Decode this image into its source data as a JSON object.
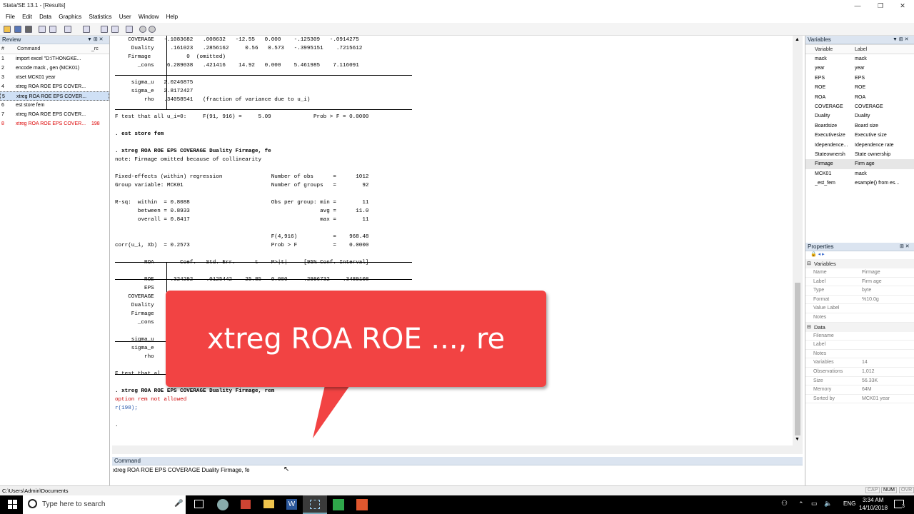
{
  "app_title": "Stata/SE 13.1 - [Results]",
  "window_controls": [
    "—",
    "❐",
    "✕"
  ],
  "menu": [
    "File",
    "Edit",
    "Data",
    "Graphics",
    "Statistics",
    "User",
    "Window",
    "Help"
  ],
  "review": {
    "title": "Review",
    "columns": [
      "#",
      "Command",
      "_rc"
    ],
    "rows": [
      {
        "n": "1",
        "cmd": "import excel \"D:\\THONGKE...",
        "rc": "",
        "state": ""
      },
      {
        "n": "2",
        "cmd": "encode mack , gen (MCK01)",
        "rc": "",
        "state": ""
      },
      {
        "n": "3",
        "cmd": "xtset MCK01 year",
        "rc": "",
        "state": ""
      },
      {
        "n": "4",
        "cmd": "xtreg ROA ROE EPS COVER...",
        "rc": "",
        "state": ""
      },
      {
        "n": "5",
        "cmd": "xtreg ROA ROE EPS COVER...",
        "rc": "",
        "state": "sel"
      },
      {
        "n": "6",
        "cmd": "est store fem",
        "rc": "",
        "state": ""
      },
      {
        "n": "7",
        "cmd": "xtreg ROA ROE EPS COVER...",
        "rc": "",
        "state": ""
      },
      {
        "n": "8",
        "cmd": "xtreg ROA ROE EPS COVER...",
        "rc": "198",
        "state": "err"
      }
    ]
  },
  "results_lines": [
    {
      "t": "    COVERAGE   -.1083682   .008632   -12.55   0.000    -.125309   -.0914275",
      "c": ""
    },
    {
      "t": "     Duality     .161023   .2856162     0.56   0.573   -.3995151    .7215612",
      "c": ""
    },
    {
      "t": "    Firmage           0  (omitted)",
      "c": ""
    },
    {
      "t": "       _cons    6.289038   .421416    14.92   0.000    5.461985    7.116091",
      "c": ""
    },
    {
      "t": "",
      "c": ""
    },
    {
      "t": "     sigma_u   2.0246875",
      "c": ""
    },
    {
      "t": "     sigma_e   2.8172427",
      "c": ""
    },
    {
      "t": "         rho   .34058541   (fraction of variance due to u_i)",
      "c": ""
    },
    {
      "t": "",
      "c": ""
    },
    {
      "t": "F test that all u_i=0:     F(91, 916) =     5.09             Prob > F = 0.0000",
      "c": ""
    },
    {
      "t": "",
      "c": ""
    },
    {
      "t": ". est store fem",
      "c": "bold"
    },
    {
      "t": "",
      "c": ""
    },
    {
      "t": ". xtreg ROA ROE EPS COVERAGE Duality Firmage, fe",
      "c": "bold"
    },
    {
      "t": "note: Firmage omitted because of collinearity",
      "c": ""
    },
    {
      "t": "",
      "c": ""
    },
    {
      "t": "Fixed-effects (within) regression               Number of obs      =      1012",
      "c": ""
    },
    {
      "t": "Group variable: MCK01                           Number of groups   =        92",
      "c": ""
    },
    {
      "t": "",
      "c": ""
    },
    {
      "t": "R-sq:  within  = 0.8088                         Obs per group: min =        11",
      "c": ""
    },
    {
      "t": "       between = 0.8933                                        avg =      11.0",
      "c": ""
    },
    {
      "t": "       overall = 0.8417                                        max =        11",
      "c": ""
    },
    {
      "t": "",
      "c": ""
    },
    {
      "t": "                                                F(4,916)           =    968.48",
      "c": ""
    },
    {
      "t": "corr(u_i, Xb)  = 0.2573                         Prob > F           =    0.0000",
      "c": ""
    },
    {
      "t": "",
      "c": ""
    },
    {
      "t": "         ROA        Coef.   Std. Err.      t    P>|t|     [95% Conf. Interval]",
      "c": ""
    },
    {
      "t": "",
      "c": ""
    },
    {
      "t": "         ROE     .324292    .0125442    25.85   0.000     .2996732    .3489108",
      "c": ""
    },
    {
      "t": "         EPS",
      "c": ""
    },
    {
      "t": "    COVERAGE",
      "c": ""
    },
    {
      "t": "     Duality",
      "c": ""
    },
    {
      "t": "     Firmage",
      "c": ""
    },
    {
      "t": "       _cons",
      "c": ""
    },
    {
      "t": "",
      "c": ""
    },
    {
      "t": "     sigma_u",
      "c": ""
    },
    {
      "t": "     sigma_e",
      "c": ""
    },
    {
      "t": "         rho",
      "c": ""
    },
    {
      "t": "",
      "c": ""
    },
    {
      "t": "F test that al",
      "c": ""
    },
    {
      "t": "",
      "c": ""
    },
    {
      "t": ". xtreg ROA ROE EPS COVERAGE Duality Firmage, rem",
      "c": "bold"
    },
    {
      "t": "option rem not allowed",
      "c": "red"
    },
    {
      "t": "r(198);",
      "c": "blue"
    },
    {
      "t": "",
      "c": ""
    },
    {
      "t": ".",
      "c": ""
    }
  ],
  "command": {
    "title": "Command",
    "value": "xtreg ROA ROE EPS COVERAGE Duality Firmage, fe"
  },
  "variables": {
    "title": "Variables",
    "columns": [
      "Variable",
      "Label"
    ],
    "rows": [
      {
        "name": "mack",
        "label": "mack"
      },
      {
        "name": "year",
        "label": "year"
      },
      {
        "name": "EPS",
        "label": "EPS"
      },
      {
        "name": "ROE",
        "label": "ROE"
      },
      {
        "name": "ROA",
        "label": "ROA"
      },
      {
        "name": "COVERAGE",
        "label": "COVERAGE"
      },
      {
        "name": "Duality",
        "label": "Duality"
      },
      {
        "name": "Boardsize",
        "label": "Board size"
      },
      {
        "name": "Executivesize",
        "label": "Executive size"
      },
      {
        "name": "Idependence...",
        "label": "Idependence rate"
      },
      {
        "name": "Stateownersh",
        "label": "State ownership"
      },
      {
        "name": "Firmage",
        "label": "Firm age"
      },
      {
        "name": "MCK01",
        "label": "mack"
      },
      {
        "name": "_est_fem",
        "label": "esample() from es..."
      }
    ]
  },
  "properties": {
    "title": "Properties",
    "sections": [
      {
        "title": "Variables",
        "rows": [
          {
            "k": "Name",
            "v": "Firmage"
          },
          {
            "k": "Label",
            "v": "Firm age"
          },
          {
            "k": "Type",
            "v": "byte"
          },
          {
            "k": "Format",
            "v": "%10.0g"
          },
          {
            "k": "Value Label",
            "v": ""
          },
          {
            "k": "Notes",
            "v": ""
          }
        ]
      },
      {
        "title": "Data",
        "rows": [
          {
            "k": "Filename",
            "v": ""
          },
          {
            "k": "Label",
            "v": ""
          },
          {
            "k": "Notes",
            "v": ""
          },
          {
            "k": "Variables",
            "v": "14"
          },
          {
            "k": "Observations",
            "v": "1,012"
          },
          {
            "k": "Size",
            "v": "56.33K"
          },
          {
            "k": "Memory",
            "v": "64M"
          },
          {
            "k": "Sorted by",
            "v": "MCK01 year"
          }
        ]
      }
    ]
  },
  "status": {
    "path": "C:\\Users\\Admin\\Documents",
    "indicators": [
      "CAP",
      "NUM",
      "OVR"
    ]
  },
  "taskbar": {
    "search_placeholder": "Type here to search",
    "lang": "ENG",
    "time": "3:34 AM",
    "date": "14/10/2018",
    "notifications": "3"
  },
  "callout": {
    "text": "xtreg ROA ROE ..., re",
    "color": "#f24343"
  }
}
